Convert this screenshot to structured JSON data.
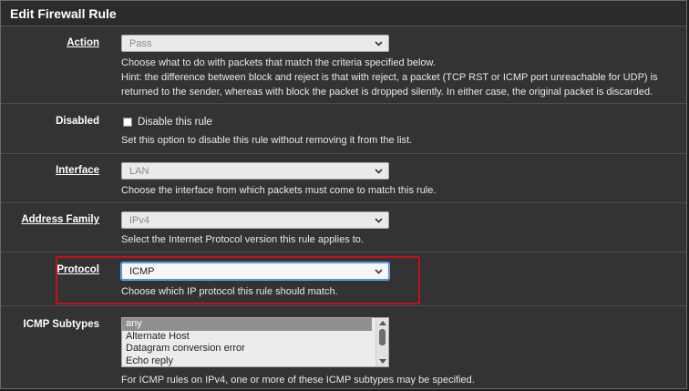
{
  "panel": {
    "title": "Edit Firewall Rule"
  },
  "action": {
    "label": "Action",
    "value": "Pass",
    "help": [
      "Choose what to do with packets that match the criteria specified below.",
      "Hint: the difference between block and reject is that with reject, a packet (TCP RST or ICMP port unreachable for UDP) is",
      "returned to the sender, whereas with block the packet is dropped silently. In either case, the original packet is discarded."
    ]
  },
  "disabled": {
    "label": "Disabled",
    "checkbox_label": "Disable this rule",
    "checked": false,
    "help": "Set this option to disable this rule without removing it from the list."
  },
  "interface": {
    "label": "Interface",
    "value": "LAN",
    "help": "Choose the interface from which packets must come to match this rule."
  },
  "address_family": {
    "label": "Address Family",
    "value": "IPv4",
    "help": "Select the Internet Protocol version this rule applies to."
  },
  "protocol": {
    "label": "Protocol",
    "value": "ICMP",
    "help": "Choose which IP protocol this rule should match."
  },
  "icmp_subtypes": {
    "label": "ICMP Subtypes",
    "options": [
      "any",
      "Alternate Host",
      "Datagram conversion error",
      "Echo reply"
    ],
    "selected": "any",
    "help": "For ICMP rules on IPv4, one or more of these ICMP subtypes may be specified."
  },
  "colors": {
    "background": "#333333",
    "highlight": "#c0131b",
    "active_border": "#4a90d9"
  },
  "icons": {
    "dropdown": "chevron-down-icon"
  }
}
